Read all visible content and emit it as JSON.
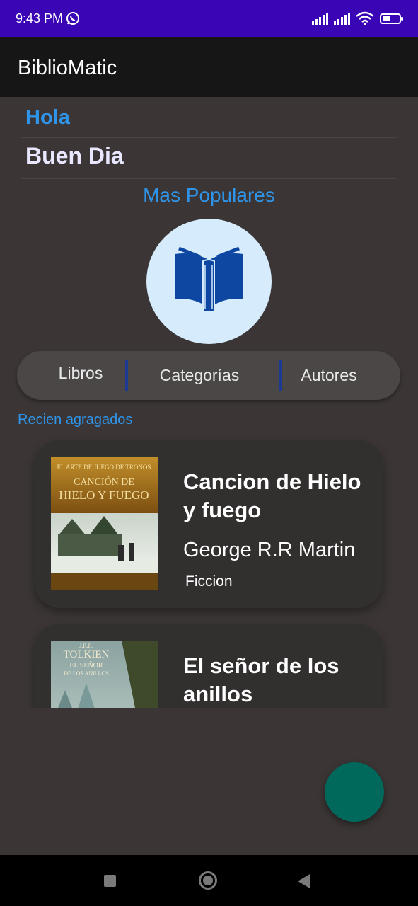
{
  "status_bar": {
    "time": "9:43 PM",
    "icons": [
      "whatsapp-icon",
      "signal-icon",
      "signal-icon",
      "wifi-icon",
      "battery-icon"
    ],
    "battery_level": 0.5
  },
  "app_bar": {
    "title": "BiblioMatic"
  },
  "greeting": {
    "hello": "Hola",
    "good_day": "Buen Dia"
  },
  "popular": {
    "title": "Mas Populares",
    "icon": "open-book-icon"
  },
  "tabs": [
    {
      "label": "Libros"
    },
    {
      "label": "Categorías"
    },
    {
      "label": "Autores"
    }
  ],
  "recent": {
    "title": "Recien agragados",
    "books": [
      {
        "title": "Cancion de Hielo y fuego",
        "author": "George R.R Martin",
        "category": "Ficcion",
        "cover_text": [
          "EL ARTE DE JUEGO DE TRONOS",
          "CANCIÓN DE",
          "HIELO Y FUEGO"
        ]
      },
      {
        "title": "El señor de los anillos",
        "author": "",
        "category": "",
        "cover_text": [
          "J.R.R.",
          "TOLKIEN",
          "EL SEÑOR",
          "DE LOS ANILLOS"
        ]
      }
    ]
  },
  "colors": {
    "accent": "#2e95ea",
    "status_bar": "#3a06b5",
    "app_bar": "#161616",
    "background": "#3b3635",
    "fab": "#00695c",
    "tab_separator": "#1d3a93"
  },
  "fab": {
    "icon": ""
  },
  "nav_bar": {
    "icons": [
      "recents-square-icon",
      "home-circle-icon",
      "back-triangle-icon"
    ]
  }
}
